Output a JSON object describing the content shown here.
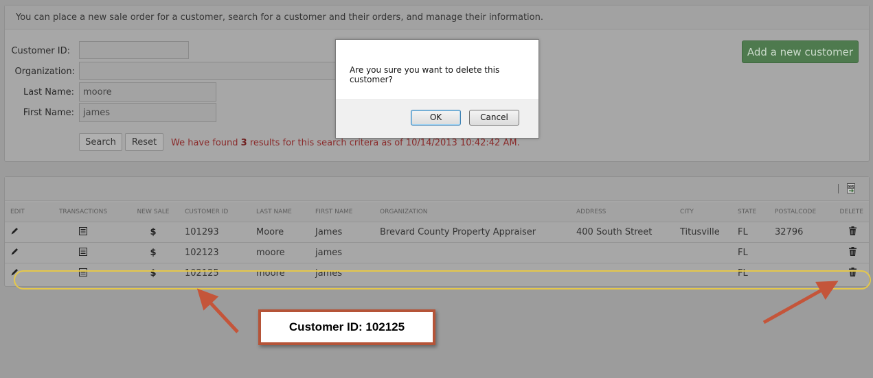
{
  "intro": "You can place a new sale order for a customer, search for a customer and their orders, and manage their information.",
  "search_form": {
    "customer_id_label": "Customer ID:",
    "customer_id_value": "",
    "organization_label": "Organization:",
    "organization_value": "",
    "last_name_label": "Last Name:",
    "last_name_value": "moore",
    "first_name_label": "First Name:",
    "first_name_value": "james",
    "search_button": "Search",
    "reset_button": "Reset",
    "result_prefix": "We have found",
    "result_count": "3",
    "result_suffix": "results for this search critera as of 10/14/2013 10:42:42 AM."
  },
  "add_customer_button": "Add a new customer",
  "grid": {
    "export_icon": "csv-export-icon",
    "columns": [
      "EDIT",
      "TRANSACTIONS",
      "NEW SALE",
      "CUSTOMER ID",
      "LAST NAME",
      "FIRST NAME",
      "ORGANIZATION",
      "ADDRESS",
      "CITY",
      "STATE",
      "POSTALCODE",
      "DELETE"
    ],
    "rows": [
      {
        "customer_id": "101293",
        "last_name": "Moore",
        "first_name": "James",
        "organization": "Brevard County Property Appraiser",
        "address": "400 South Street",
        "city": "Titusville",
        "state": "FL",
        "postalcode": "32796"
      },
      {
        "customer_id": "102123",
        "last_name": "moore",
        "first_name": "james",
        "organization": "",
        "address": "",
        "city": "",
        "state": "FL",
        "postalcode": ""
      },
      {
        "customer_id": "102125",
        "last_name": "moore",
        "first_name": "james",
        "organization": "",
        "address": "",
        "city": "",
        "state": "FL",
        "postalcode": ""
      }
    ],
    "icons": {
      "edit": "pencil-icon",
      "transactions": "list-icon",
      "new_sale": "dollar-icon",
      "delete": "trash-icon"
    },
    "new_sale_glyph": "$"
  },
  "dialog": {
    "message": "Are you sure you want to delete this customer?",
    "ok": "OK",
    "cancel": "Cancel"
  },
  "annotation": {
    "callout": "Customer ID: 102125",
    "arrow_color": "#c4553a",
    "highlight_color": "#e5c84a"
  }
}
